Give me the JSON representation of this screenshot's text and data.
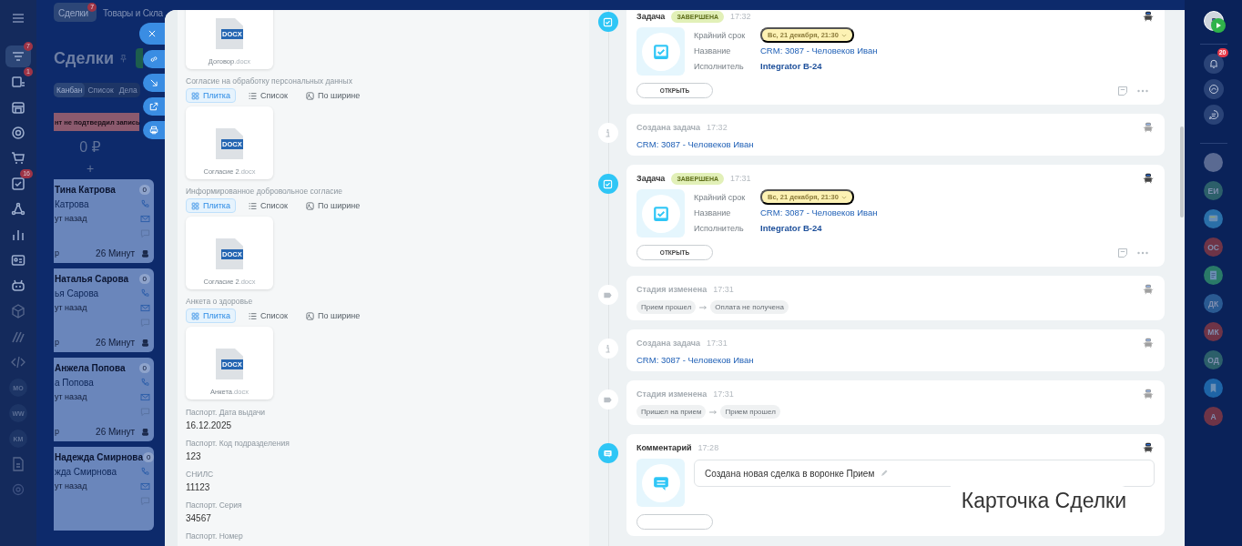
{
  "left_nav": {
    "items": [
      {
        "badge": "7",
        "selected": true
      },
      {
        "badge": "1",
        "selected": false
      },
      {
        "selected": false
      },
      {
        "selected": false
      },
      {
        "selected": false
      },
      {
        "badge": "16",
        "selected": false
      },
      {
        "selected": false
      },
      {
        "selected": false
      },
      {
        "selected": false
      },
      {
        "selected": false
      },
      {
        "selected": false
      },
      {
        "selected": false
      },
      {
        "selected": false
      },
      {
        "text": "MO",
        "selected": false
      },
      {
        "text": "WW",
        "selected": false
      },
      {
        "text": "KM",
        "selected": false
      },
      {
        "selected": false
      },
      {
        "selected": false
      }
    ]
  },
  "header": {
    "tabs": [
      {
        "label": "Сделки",
        "badge": "7",
        "selected": true
      },
      {
        "label": "Товары и Скла",
        "selected": false
      }
    ]
  },
  "kanban": {
    "title": "Сделки",
    "views": [
      {
        "label": "Канбан",
        "selected": true
      },
      {
        "label": "Список",
        "selected": false
      },
      {
        "label": "Дела",
        "selected": false
      }
    ],
    "stage": {
      "label": "нт не подтвердил запись",
      "color": "#8c5a6e"
    },
    "sum": "0 ₽",
    "add": "+",
    "cards": [
      {
        "name": "Тина Катрова",
        "contact": "Катрова",
        "ago": "ут назад",
        "counter": "0",
        "left": "р",
        "age": "26 Минут"
      },
      {
        "name": "Наталья Сарова",
        "contact": "ья Сарова",
        "ago": "ут назад",
        "counter": "0",
        "left": "р",
        "age": "26 Минут"
      },
      {
        "name": "Анжела Попова",
        "contact": "а Попова",
        "ago": "ут назад",
        "counter": "0",
        "left": "р",
        "age": "26 Минут"
      },
      {
        "name": "Надежда Смирнова",
        "contact": "жда Смирнова",
        "ago": "ут назад",
        "counter": "0"
      }
    ]
  },
  "details": {
    "sections": [
      {
        "files": [
          {
            "name": "Договор",
            "ext": ".docx",
            "badge": "DOCX"
          }
        ]
      },
      {
        "label": "Согласие на обработку персональных данных",
        "views": [
          {
            "label": "Плитка",
            "selected": true
          },
          {
            "label": "Список",
            "selected": false
          },
          {
            "label": "По ширине",
            "selected": false
          }
        ],
        "files": [
          {
            "name": "Согласие 2",
            "ext": ".docx",
            "badge": "DOCX"
          }
        ]
      },
      {
        "label": "Информированное добровольное согласие",
        "views": [
          {
            "label": "Плитка",
            "selected": true
          },
          {
            "label": "Список",
            "selected": false
          },
          {
            "label": "По ширине",
            "selected": false
          }
        ],
        "files": [
          {
            "name": "Согласие 2",
            "ext": ".docx",
            "badge": "DOCX"
          }
        ]
      },
      {
        "label": "Анкета о здоровье",
        "views": [
          {
            "label": "Плитка",
            "selected": true
          },
          {
            "label": "Список",
            "selected": false
          },
          {
            "label": "По ширине",
            "selected": false
          }
        ],
        "files": [
          {
            "name": "Анкета",
            "ext": ".docx",
            "badge": "DOCX"
          }
        ]
      }
    ],
    "fields": [
      {
        "label": "Паспорт. Дата выдачи",
        "value": "16.12.2025"
      },
      {
        "label": "Паспорт. Код подразделения",
        "value": "123"
      },
      {
        "label": "СНИЛС",
        "value": "11123"
      },
      {
        "label": "Паспорт. Серия",
        "value": "34567"
      },
      {
        "label": "Паспорт. Номер"
      }
    ]
  },
  "timeline": {
    "items": [
      {
        "kind": "task",
        "title": "Задача",
        "status": "ЗАВЕРШЕНА",
        "time": "17:32",
        "fields": [
          {
            "label": "Крайний срок",
            "value": "Вс, 21 декабря, 21:30",
            "kind": "date"
          },
          {
            "label": "Название",
            "value": "CRM: 3087 - Человеков Иван",
            "kind": "link"
          },
          {
            "label": "Исполнитель",
            "value": "Integrator B-24",
            "kind": "user"
          }
        ],
        "button": "ОТКРЫТЬ"
      },
      {
        "kind": "info",
        "title": "Создана задача",
        "time": "17:32",
        "link": "CRM: 3087 - Человеков Иван"
      },
      {
        "kind": "task",
        "title": "Задача",
        "status": "ЗАВЕРШЕНА",
        "time": "17:31",
        "fields": [
          {
            "label": "Крайний срок",
            "value": "Вс, 21 декабря, 21:30",
            "kind": "date"
          },
          {
            "label": "Название",
            "value": "CRM: 3087 - Человеков Иван",
            "kind": "link"
          },
          {
            "label": "Исполнитель",
            "value": "Integrator B-24",
            "kind": "user"
          }
        ],
        "button": "ОТКРЫТЬ"
      },
      {
        "kind": "stage",
        "title": "Стадия изменена",
        "time": "17:31",
        "from": "Прием прошел",
        "to": "Оплата не получена"
      },
      {
        "kind": "info",
        "title": "Создана задача",
        "time": "17:31",
        "link": "CRM: 3087 - Человеков Иван"
      },
      {
        "kind": "stage",
        "title": "Стадия изменена",
        "time": "17:31",
        "from": "Пришел на прием",
        "to": "Прием прошел"
      },
      {
        "kind": "comment",
        "title": "Комментарий",
        "time": "17:28",
        "text": "Создана новая сделка в воронке Прием"
      }
    ]
  },
  "caption": "Карточка Сделки",
  "right_bar": {
    "bell_badge": "20",
    "contacts": [
      {
        "kind": "photo"
      },
      {
        "kind": "initials",
        "text": "ЕИ",
        "color": "#2c5f6a"
      },
      {
        "kind": "chat",
        "color": "#2a6fa8"
      },
      {
        "kind": "initials",
        "text": "ОС",
        "color": "#6e3447"
      },
      {
        "kind": "doc",
        "color": "#2a7a68"
      },
      {
        "kind": "initials",
        "text": "ДК",
        "color": "#2a5a92"
      },
      {
        "kind": "initials",
        "text": "МК",
        "color": "#6e3447"
      },
      {
        "kind": "initials",
        "text": "ОД",
        "color": "#2c5f6a"
      },
      {
        "kind": "bookmark",
        "color": "#1e64a6"
      },
      {
        "kind": "initials",
        "text": "А",
        "color": "#6e3447"
      }
    ]
  }
}
